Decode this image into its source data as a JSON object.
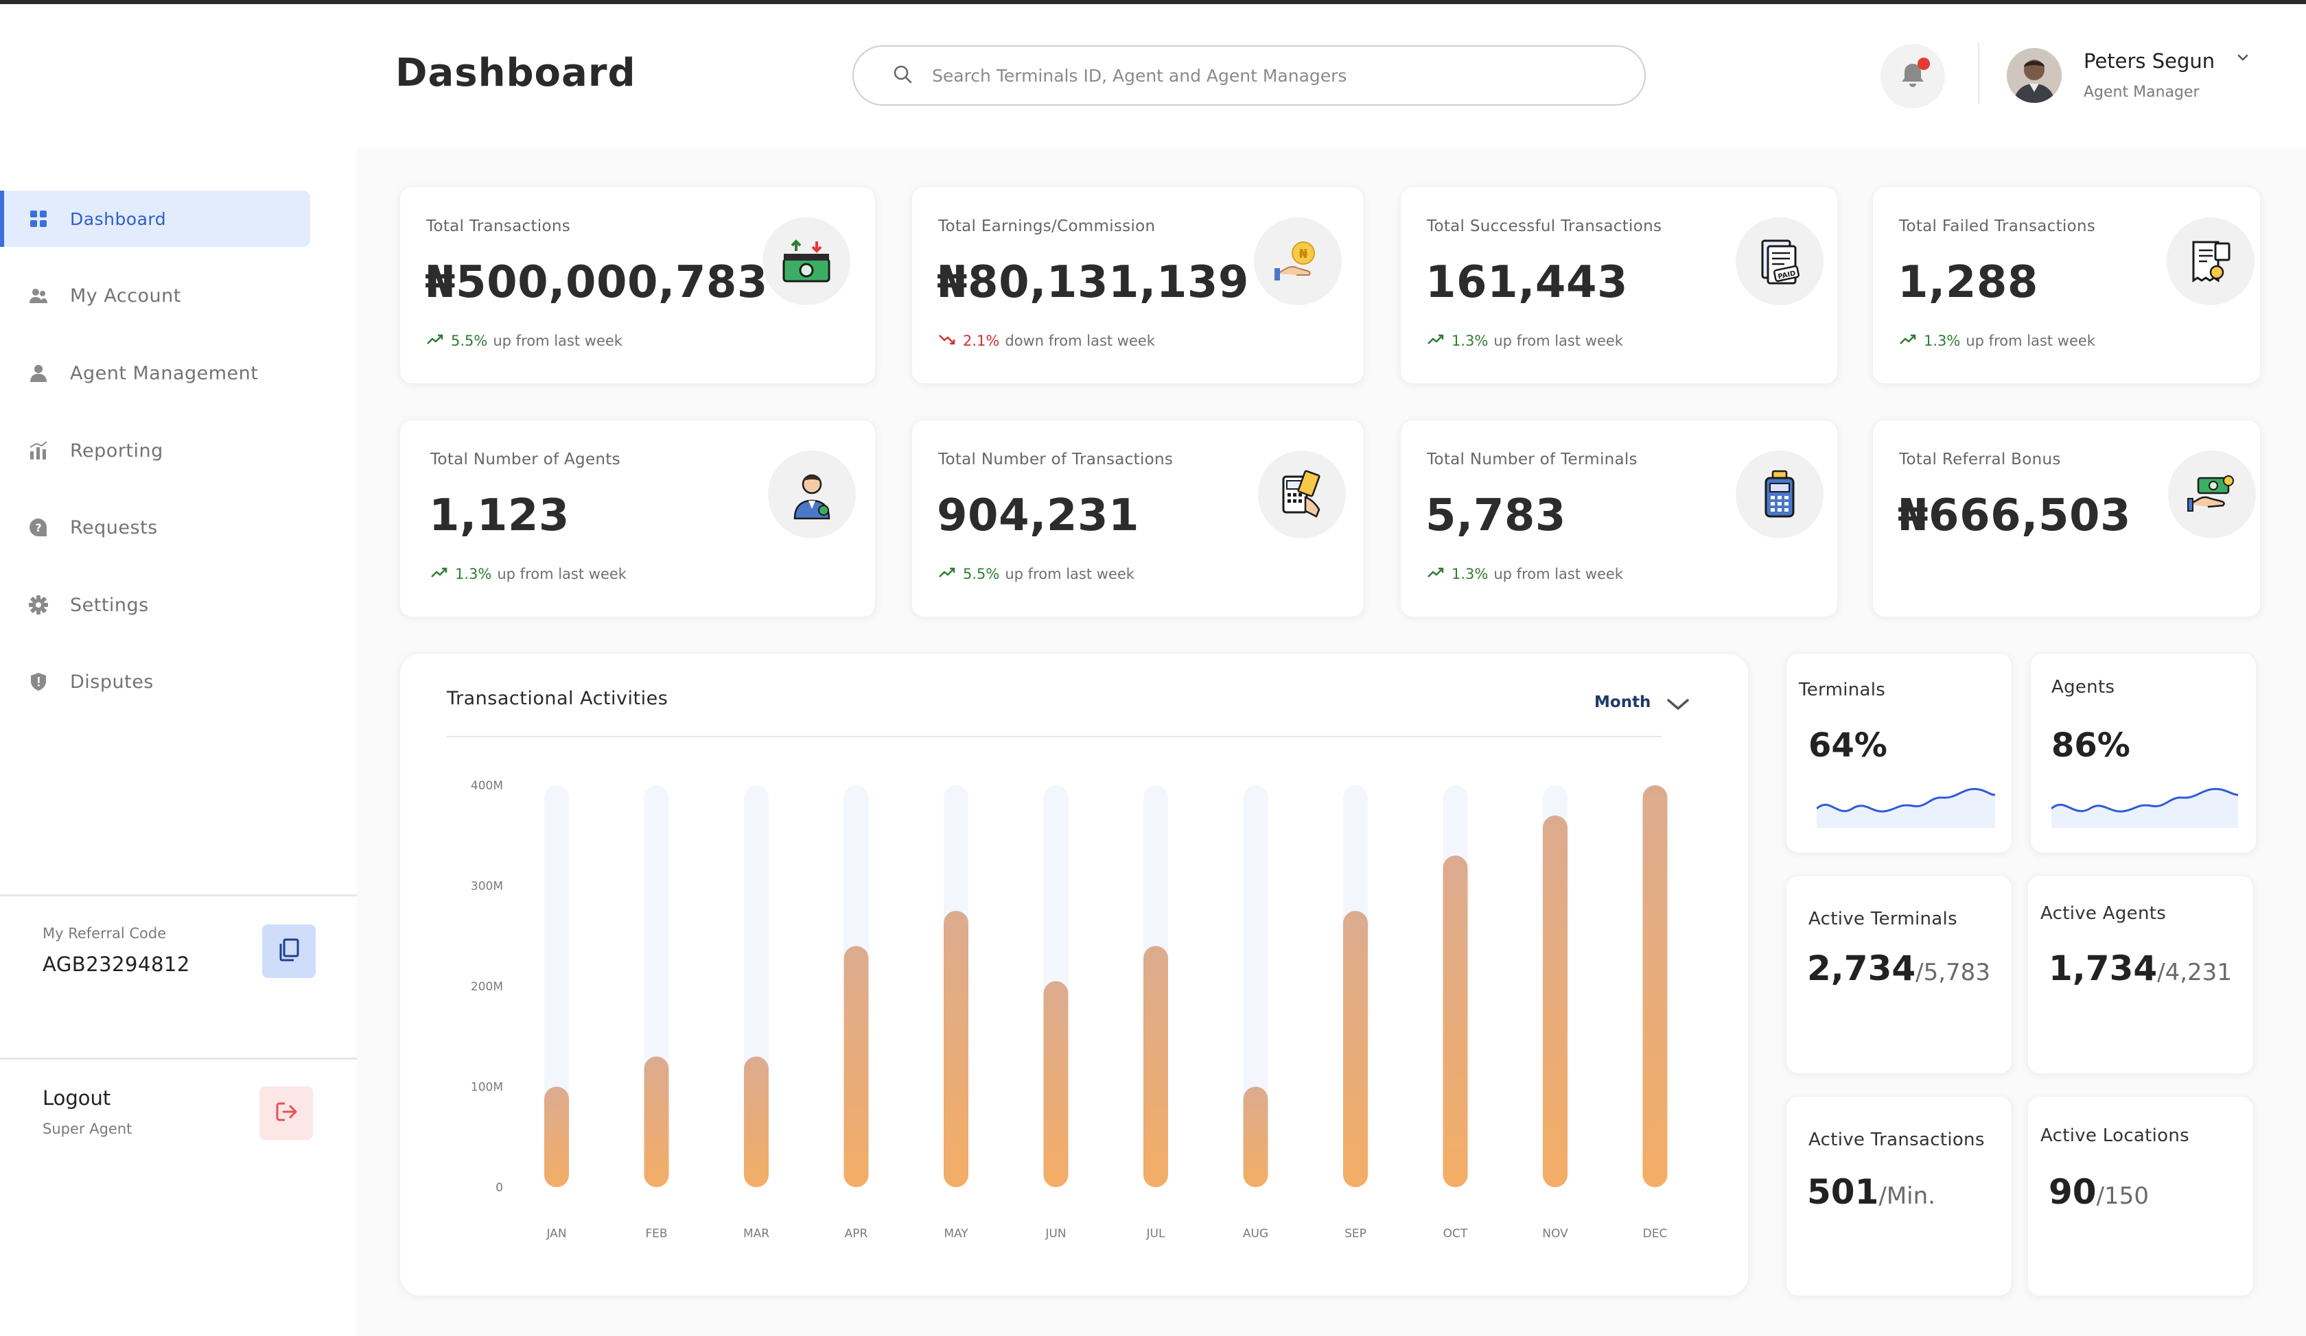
{
  "header": {
    "title": "Dashboard",
    "search_placeholder": "Search Terminals ID, Agent and Agent Managers",
    "user": {
      "name": "Peters Segun",
      "role": "Agent Manager"
    }
  },
  "sidebar": {
    "items": [
      {
        "label": "Dashboard",
        "icon": "grid-icon",
        "active": true
      },
      {
        "label": "My Account",
        "icon": "users-icon"
      },
      {
        "label": "Agent Management",
        "icon": "user-icon"
      },
      {
        "label": "Reporting",
        "icon": "bar-chart-icon"
      },
      {
        "label": "Requests",
        "icon": "help-circle-icon"
      },
      {
        "label": "Settings",
        "icon": "gear-icon"
      },
      {
        "label": "Disputes",
        "icon": "shield-icon"
      }
    ],
    "referral": {
      "label": "My Referral Code",
      "code": "AGB23294812"
    },
    "logout": {
      "label": "Logout",
      "sub": "Super Agent"
    }
  },
  "stats": [
    {
      "title": "Total Transactions",
      "value": "₦500,000,783",
      "trend": {
        "direction": "up",
        "pct": "5.5%",
        "text": "up from last week"
      },
      "icon": "money-transfer-icon"
    },
    {
      "title": "Total Earnings/Commission",
      "value": "₦80,131,139",
      "trend": {
        "direction": "down",
        "pct": "2.1%",
        "text": "down from last week"
      },
      "icon": "coin-hand-icon"
    },
    {
      "title": "Total Successful Transactions",
      "value": "161,443",
      "trend": {
        "direction": "up",
        "pct": "1.3%",
        "text": "up from last week"
      },
      "icon": "paid-invoice-icon"
    },
    {
      "title": "Total Failed Transactions",
      "value": "1,288",
      "trend": {
        "direction": "up",
        "pct": "1.3%",
        "text": "up from last week"
      },
      "icon": "failed-receipt-icon"
    },
    {
      "title": "Total Number of Agents",
      "value": "1,123",
      "trend": {
        "direction": "up",
        "pct": "1.3%",
        "text": "up from last week"
      },
      "icon": "agent-person-icon"
    },
    {
      "title": "Total Number of Transactions",
      "value": "904,231",
      "trend": {
        "direction": "up",
        "pct": "5.5%",
        "text": "up from last week"
      },
      "icon": "card-terminal-icon"
    },
    {
      "title": "Total Number of Terminals",
      "value": "5,783",
      "trend": {
        "direction": "up",
        "pct": "1.3%",
        "text": "up from last week"
      },
      "icon": "pos-terminal-icon"
    },
    {
      "title": "Total Referral Bonus",
      "value": "₦666,503",
      "icon": "cash-hand-icon"
    }
  ],
  "mini": {
    "terminals": {
      "title": "Terminals",
      "value": "64%"
    },
    "agents": {
      "title": "Agents",
      "value": "86%"
    },
    "active_terminals": {
      "title": "Active Terminals",
      "value": "2,734",
      "total": "/5,783"
    },
    "active_agents": {
      "title": "Active Agents",
      "value": "1,734",
      "total": "/4,231"
    },
    "active_transactions": {
      "title": "Active Transactions",
      "value": "501",
      "unit": "/Min."
    },
    "active_locations": {
      "title": "Active Locations",
      "value": "90",
      "total": "/150"
    }
  },
  "chart_data": {
    "type": "bar",
    "title": "Transactional Activities",
    "filter": "Month",
    "categories": [
      "JAN",
      "FEB",
      "MAR",
      "APR",
      "MAY",
      "JUN",
      "JUL",
      "AUG",
      "SEP",
      "OCT",
      "NOV",
      "DEC"
    ],
    "values": [
      100,
      130,
      130,
      240,
      275,
      205,
      240,
      100,
      275,
      330,
      370,
      400
    ],
    "ytick_labels": [
      "0",
      "100M",
      "200M",
      "300M",
      "400M"
    ],
    "yticks": [
      0,
      100,
      200,
      300,
      400
    ],
    "ylim": [
      0,
      400
    ],
    "colors": {
      "bar": "#f3ad66",
      "bar_top": "#dcab8f",
      "track": "#f3f6fd"
    }
  },
  "colors": {
    "accent": "#3a6fdc",
    "up": "#2e7d32",
    "down": "#d32f2f",
    "sparkline": "#2f5bd8"
  }
}
